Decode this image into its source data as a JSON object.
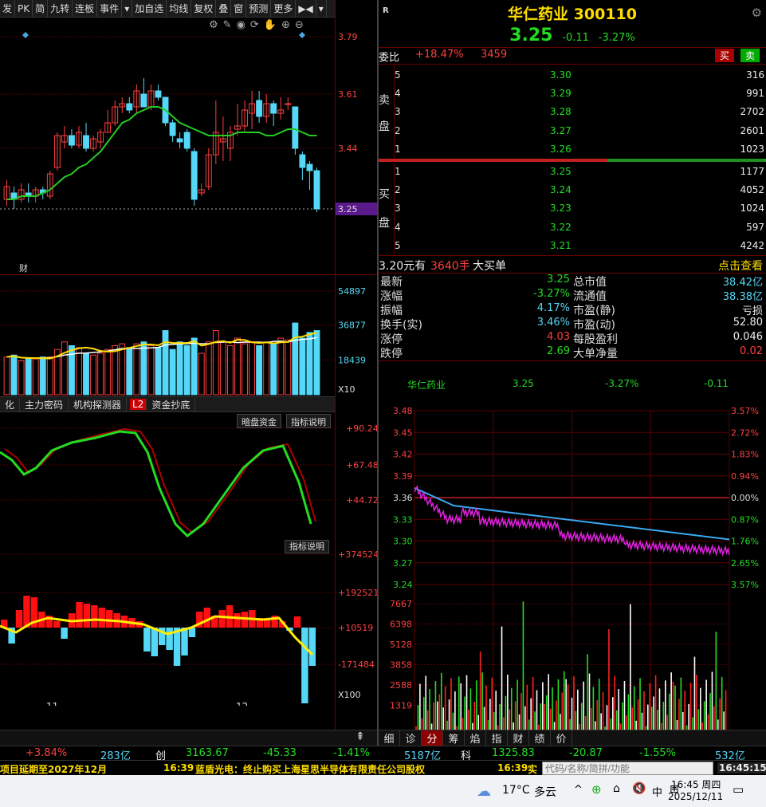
{
  "toolbar": {
    "items": [
      "发",
      "PK",
      "简",
      "九转",
      "连板",
      "事件",
      "▾",
      "加自选",
      "均线",
      "复权",
      "叠",
      "窗",
      "预测",
      "更多",
      "▶◀",
      "▾"
    ]
  },
  "kline": {
    "price_ticks": [
      "3.79",
      "3.61",
      "3.44",
      "3.25"
    ],
    "last_price_tag": "3.25",
    "fin_marker": "财",
    "volume_ticks": [
      "54897",
      "36877",
      "18439"
    ],
    "volume_unit": "X10",
    "date_labels": [
      "11",
      "12"
    ],
    "candles": [
      {
        "o": 3.28,
        "c": 3.32,
        "h": 3.34,
        "l": 3.26
      },
      {
        "o": 3.3,
        "c": 3.28,
        "h": 3.32,
        "l": 3.25
      },
      {
        "o": 3.28,
        "c": 3.31,
        "h": 3.33,
        "l": 3.27
      },
      {
        "o": 3.3,
        "c": 3.29,
        "h": 3.33,
        "l": 3.27
      },
      {
        "o": 3.29,
        "c": 3.31,
        "h": 3.32,
        "l": 3.27
      },
      {
        "o": 3.31,
        "c": 3.3,
        "h": 3.32,
        "l": 3.28
      },
      {
        "o": 3.29,
        "c": 3.36,
        "h": 3.37,
        "l": 3.28
      },
      {
        "o": 3.38,
        "c": 3.48,
        "h": 3.49,
        "l": 3.37
      },
      {
        "o": 3.46,
        "c": 3.48,
        "h": 3.51,
        "l": 3.44
      },
      {
        "o": 3.48,
        "c": 3.45,
        "h": 3.5,
        "l": 3.44
      },
      {
        "o": 3.45,
        "c": 3.49,
        "h": 3.51,
        "l": 3.44
      },
      {
        "o": 3.48,
        "c": 3.44,
        "h": 3.52,
        "l": 3.43
      },
      {
        "o": 3.44,
        "c": 3.47,
        "h": 3.48,
        "l": 3.43
      },
      {
        "o": 3.46,
        "c": 3.49,
        "h": 3.5,
        "l": 3.44
      },
      {
        "o": 3.49,
        "c": 3.52,
        "h": 3.56,
        "l": 3.49
      },
      {
        "o": 3.52,
        "c": 3.57,
        "h": 3.59,
        "l": 3.51
      },
      {
        "o": 3.57,
        "c": 3.58,
        "h": 3.6,
        "l": 3.55
      },
      {
        "o": 3.58,
        "c": 3.56,
        "h": 3.6,
        "l": 3.55
      },
      {
        "o": 3.57,
        "c": 3.62,
        "h": 3.64,
        "l": 3.55
      },
      {
        "o": 3.61,
        "c": 3.57,
        "h": 3.66,
        "l": 3.57
      },
      {
        "o": 3.57,
        "c": 3.62,
        "h": 3.64,
        "l": 3.56
      },
      {
        "o": 3.62,
        "c": 3.6,
        "h": 3.64,
        "l": 3.59
      },
      {
        "o": 3.6,
        "c": 3.52,
        "h": 3.6,
        "l": 3.51
      },
      {
        "o": 3.52,
        "c": 3.48,
        "h": 3.53,
        "l": 3.46
      },
      {
        "o": 3.47,
        "c": 3.46,
        "h": 3.49,
        "l": 3.44
      },
      {
        "o": 3.49,
        "c": 3.44,
        "h": 3.5,
        "l": 3.43
      },
      {
        "o": 3.43,
        "c": 3.28,
        "h": 3.44,
        "l": 3.26
      },
      {
        "o": 3.3,
        "c": 3.31,
        "h": 3.33,
        "l": 3.29
      },
      {
        "o": 3.32,
        "c": 3.42,
        "h": 3.44,
        "l": 3.31
      },
      {
        "o": 3.42,
        "c": 3.49,
        "h": 3.59,
        "l": 3.39
      },
      {
        "o": 3.46,
        "c": 3.47,
        "h": 3.54,
        "l": 3.4
      },
      {
        "o": 3.44,
        "c": 3.49,
        "h": 3.51,
        "l": 3.4
      },
      {
        "o": 3.5,
        "c": 3.51,
        "h": 3.58,
        "l": 3.48
      },
      {
        "o": 3.51,
        "c": 3.56,
        "h": 3.59,
        "l": 3.49
      },
      {
        "o": 3.55,
        "c": 3.58,
        "h": 3.62,
        "l": 3.5
      },
      {
        "o": 3.59,
        "c": 3.54,
        "h": 3.62,
        "l": 3.52
      },
      {
        "o": 3.54,
        "c": 3.58,
        "h": 3.61,
        "l": 3.52
      },
      {
        "o": 3.58,
        "c": 3.55,
        "h": 3.59,
        "l": 3.51
      },
      {
        "o": 3.55,
        "c": 3.56,
        "h": 3.6,
        "l": 3.53
      },
      {
        "o": 3.58,
        "c": 3.58,
        "h": 3.6,
        "l": 3.56
      },
      {
        "o": 3.57,
        "c": 3.44,
        "h": 3.57,
        "l": 3.42
      },
      {
        "o": 3.42,
        "c": 3.38,
        "h": 3.43,
        "l": 3.34
      },
      {
        "o": 3.39,
        "c": 3.37,
        "h": 3.4,
        "l": 3.31
      },
      {
        "o": 3.37,
        "c": 3.25,
        "h": 3.38,
        "l": 3.24
      }
    ],
    "ma": [
      3.28,
      3.28,
      3.29,
      3.29,
      3.29,
      3.3,
      3.31,
      3.33,
      3.35,
      3.36,
      3.38,
      3.39,
      3.41,
      3.43,
      3.46,
      3.49,
      3.52,
      3.53,
      3.55,
      3.56,
      3.57,
      3.57,
      3.56,
      3.54,
      3.52,
      3.51,
      3.5,
      3.49,
      3.48,
      3.48,
      3.48,
      3.48,
      3.49,
      3.49,
      3.49,
      3.49,
      3.48,
      3.48,
      3.49,
      3.5,
      3.5,
      3.49,
      3.48,
      3.48
    ],
    "volumes": [
      20,
      21,
      18,
      19,
      19,
      20,
      20,
      24,
      28,
      26,
      25,
      22,
      21,
      22,
      24,
      26,
      27,
      25,
      27,
      28,
      26,
      25,
      34,
      24,
      28,
      26,
      30,
      22,
      28,
      34,
      28,
      26,
      30,
      27,
      28,
      26,
      28,
      27,
      30,
      29,
      38,
      30,
      33,
      34
    ]
  },
  "indicator_tabs": [
    "化",
    "主力密码",
    "机构探测器",
    "L2",
    "资金抄底"
  ],
  "indicator1": {
    "btn1": "暗盘资金",
    "btn2": "指标说明",
    "ticks": [
      "+90.24",
      "+67.48",
      "+44.72"
    ]
  },
  "indicator2": {
    "btn": "指标说明",
    "ticks": [
      "+374524",
      "+192521",
      "+10519",
      "-171484"
    ],
    "unit": "X100"
  },
  "stock": {
    "name": "华仁药业",
    "code": "300110",
    "price": "3.25",
    "change": "-0.11",
    "change_pct": "-3.27%",
    "badge": "R"
  },
  "weibi": {
    "label": "委比",
    "pct": "+18.47%",
    "diff": "3459",
    "sell_btn": "买",
    "buy_btn": "卖"
  },
  "sell_side_label": [
    "卖",
    "盘"
  ],
  "buy_side_label": [
    "买",
    "盘"
  ],
  "asks": [
    {
      "lvl": "5",
      "price": "3.30",
      "vol": "316"
    },
    {
      "lvl": "4",
      "price": "3.29",
      "vol": "991"
    },
    {
      "lvl": "3",
      "price": "3.28",
      "vol": "2702"
    },
    {
      "lvl": "2",
      "price": "3.27",
      "vol": "2601"
    },
    {
      "lvl": "1",
      "price": "3.26",
      "vol": "1023"
    }
  ],
  "bids": [
    {
      "lvl": "1",
      "price": "3.25",
      "vol": "1177"
    },
    {
      "lvl": "2",
      "price": "3.24",
      "vol": "4052"
    },
    {
      "lvl": "3",
      "price": "3.23",
      "vol": "1024"
    },
    {
      "lvl": "4",
      "price": "3.22",
      "vol": "597"
    },
    {
      "lvl": "5",
      "price": "3.21",
      "vol": "4242"
    }
  ],
  "big_order": {
    "price": "3.20元有",
    "qty": "3640手",
    "label": "大买单",
    "link": "点击查看"
  },
  "stats": [
    {
      "l1": "最新",
      "v1": "3.25",
      "c1": "green",
      "l2": "总市值",
      "v2": "38.42亿",
      "c2": "cyan"
    },
    {
      "l1": "涨幅",
      "v1": "-3.27%",
      "c1": "green",
      "l2": "流通值",
      "v2": "38.38亿",
      "c2": "cyan"
    },
    {
      "l1": "振幅",
      "v1": "4.17%",
      "c1": "cyan",
      "l2": "市盈(静)",
      "v2": "亏损",
      "c2": "white"
    },
    {
      "l1": "换手(实)",
      "v1": "3.46%",
      "c1": "cyan",
      "l2": "市盈(动)",
      "v2": "52.80",
      "c2": "white"
    },
    {
      "l1": "涨停",
      "v1": "4.03",
      "c1": "red",
      "l2": "每股盈利",
      "v2": "0.046",
      "c2": "white"
    },
    {
      "l1": "跌停",
      "v1": "2.69",
      "c1": "green",
      "l2": "大单净量",
      "v2": "0.02",
      "c2": "red"
    }
  ],
  "intraday": {
    "header_name": "华仁药业",
    "header_price": "3.25",
    "header_pct": "-3.27%",
    "header_chg": "-0.11",
    "left_ticks": [
      "3.48",
      "3.45",
      "3.42",
      "3.39",
      "3.36",
      "3.33",
      "3.30",
      "3.27",
      "3.24"
    ],
    "right_ticks": [
      "3.57%",
      "2.72%",
      "1.83%",
      "0.94%",
      "0.00%",
      "0.87%",
      "1.76%",
      "2.65%",
      "3.57%"
    ],
    "vol_ticks": [
      "7667",
      "6398",
      "5128",
      "3858",
      "2588",
      "1319"
    ]
  },
  "bottom_tabs": [
    "细",
    "诊",
    "分",
    "筹",
    "焰",
    "指",
    "财",
    "绩",
    "价"
  ],
  "index_bar": {
    "a_pct": "+3.84%",
    "a_amt": "283亿",
    "b_name": "创",
    "b_val": "3163.67",
    "b_chg": "-45.33",
    "b_pct": "-1.41%",
    "b_amt": "5187亿",
    "c_name": "科",
    "c_val": "1325.83",
    "c_chg": "-20.87",
    "c_pct": "-1.55%",
    "c_amt": "532亿"
  },
  "news_bar": {
    "n1": "项目延期至2027年12月",
    "t2": "16:39",
    "n2": "蓝盾光电：终止购买上海星思半导体有限责任公司股权",
    "t3": "16:39",
    "n3": "实",
    "search_placeholder": "代码/名称/简拼/功能",
    "clock": "16:45:15"
  },
  "taskbar": {
    "temp": "17°C",
    "weather": "多云",
    "ime": "中",
    "time": "16:45 周四",
    "date": "2025/12/11"
  }
}
